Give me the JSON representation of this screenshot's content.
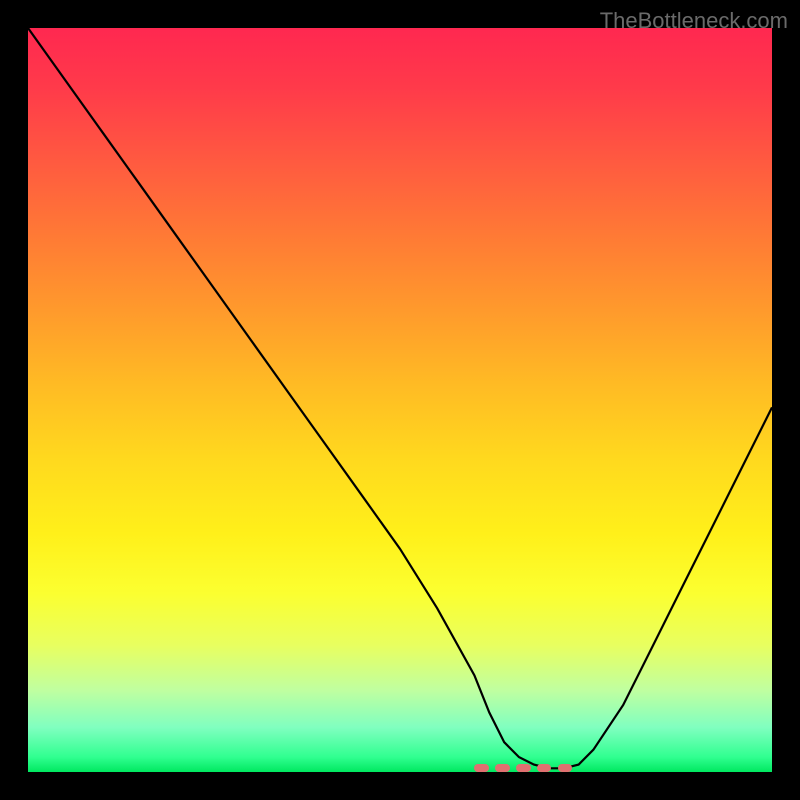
{
  "watermark": "TheBottleneck.com",
  "chart_data": {
    "type": "line",
    "title": "",
    "xlabel": "",
    "ylabel": "",
    "xlim": [
      0,
      100
    ],
    "ylim": [
      0,
      100
    ],
    "x": [
      0,
      5,
      10,
      15,
      20,
      25,
      30,
      35,
      40,
      45,
      50,
      55,
      60,
      62,
      64,
      66,
      68,
      70,
      72,
      74,
      76,
      80,
      84,
      88,
      92,
      96,
      100
    ],
    "values": [
      100,
      93,
      86,
      79,
      72,
      65,
      58,
      51,
      44,
      37,
      30,
      22,
      13,
      8,
      4,
      2,
      1,
      0.5,
      0.5,
      1,
      3,
      9,
      17,
      25,
      33,
      41,
      49
    ],
    "trough_marker": {
      "x_start": 60,
      "x_end": 74,
      "y": 0.5,
      "color": "#e07070"
    }
  },
  "colors": {
    "background": "#000000",
    "curve": "#000000",
    "marker": "#e07070",
    "watermark": "#6a6a6a"
  }
}
